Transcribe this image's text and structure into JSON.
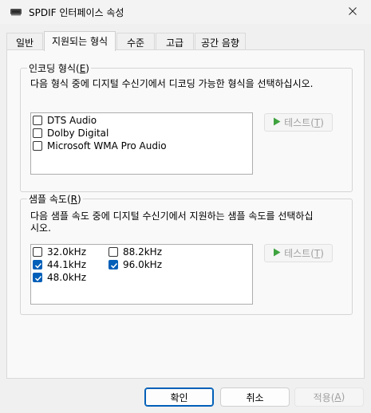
{
  "window": {
    "title": "SPDIF 인터페이스 속성",
    "icon": "speaker-device-icon",
    "close_icon": "close-icon"
  },
  "tabs": [
    {
      "label": "일반",
      "active": false
    },
    {
      "label": "지원되는 형식",
      "active": true
    },
    {
      "label": "수준",
      "active": false
    },
    {
      "label": "고급",
      "active": false
    },
    {
      "label": "공간 음향",
      "active": false
    }
  ],
  "encoding": {
    "title_text": "인코딩 형식(",
    "title_key": "E",
    "title_end": ")",
    "description": "다음 형식 중에 디지털 수신기에서 디코딩 가능한 형식을 선택하십시오.",
    "items": [
      {
        "label": "DTS Audio",
        "checked": false
      },
      {
        "label": "Dolby Digital",
        "checked": false
      },
      {
        "label": "Microsoft WMA Pro Audio",
        "checked": false
      }
    ],
    "test_text": "테스트(",
    "test_key": "T",
    "test_end": ")"
  },
  "sample_rate": {
    "title_text": "샘플 속도(",
    "title_key": "R",
    "title_end": ")",
    "description_line1": "다음 샘플 속도 중에 디지털 수신기에서 지원하는 샘플 속도를 선택하십",
    "description_line2": "시오.",
    "items": [
      {
        "label": "32.0kHz",
        "checked": false
      },
      {
        "label": "88.2kHz",
        "checked": false
      },
      {
        "label": "44.1kHz",
        "checked": true
      },
      {
        "label": "96.0kHz",
        "checked": true
      },
      {
        "label": "48.0kHz",
        "checked": true
      }
    ],
    "test_text": "테스트(",
    "test_key": "T",
    "test_end": ")"
  },
  "footer": {
    "ok_label": "확인",
    "cancel_label": "취소",
    "apply_text": "적용(",
    "apply_key": "A",
    "apply_end": ")"
  },
  "colors": {
    "accent": "#005fb8",
    "disabled_text": "#a0a0a0",
    "play_green": "#3fa33f"
  }
}
